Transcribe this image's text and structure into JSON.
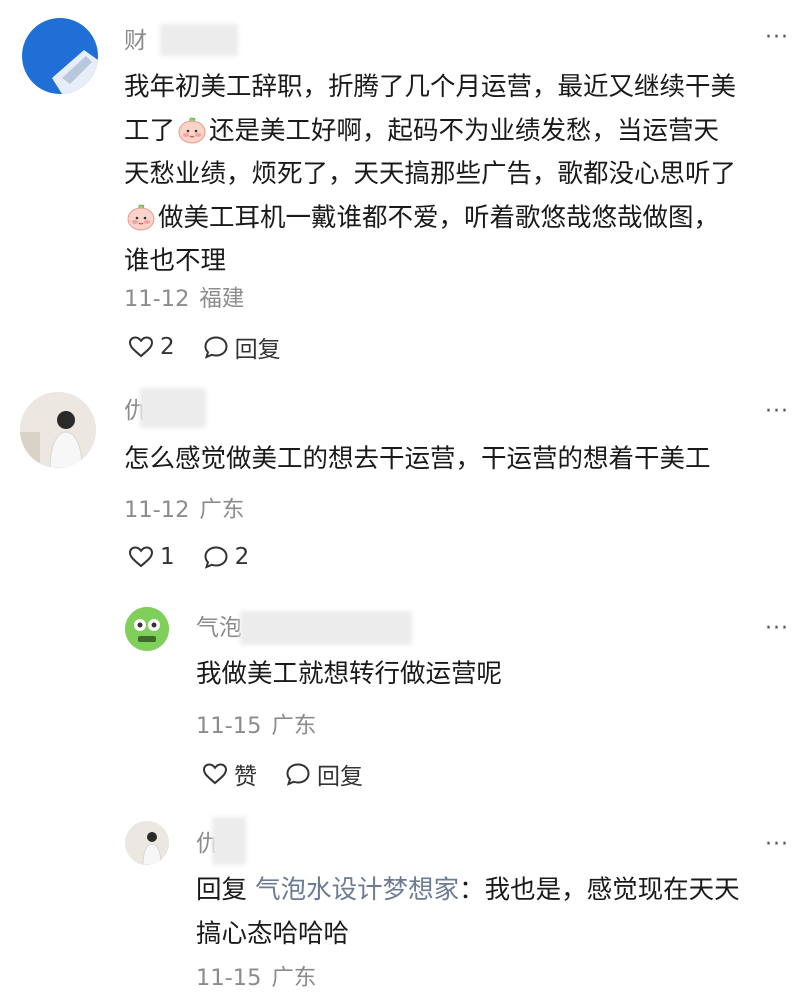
{
  "comments": [
    {
      "name_prefix": "财",
      "text_line1_a": "我年初美工辞职，折腾了几个月运营，最近又继续干美",
      "text_line2_a": "工了",
      "text_line2_b": "还是美工好啊，起码不为业绩发愁，当运营天",
      "text_line3": "天愁业绩，烦死了，天天搞那些广告，歌都没心思听了",
      "text_line4_b": "做美工耳机一戴谁都不爱，听着歌悠哉悠哉做图，",
      "text_line5": "谁也不理",
      "date": "11-12",
      "location": "福建",
      "like_count": "2",
      "reply_label": "回复",
      "emoji_icon": "baby-face-emoji"
    },
    {
      "name_prefix": "仇",
      "text": "怎么感觉做美工的想去干运营，干运营的想着干美工",
      "date": "11-12",
      "location": "广东",
      "like_count": "1",
      "reply_count": "2"
    }
  ],
  "replies": [
    {
      "name_prefix": "气泡",
      "text": "我做美工就想转行做运营呢",
      "date": "11-15",
      "location": "广东",
      "like_label": "赞",
      "reply_label": "回复"
    },
    {
      "name_prefix": "仇",
      "reply_prefix": "回复",
      "reply_to": "气泡水设计梦想家",
      "text_line1": "：我也是，感觉现在天天",
      "text_line2": "搞心态哈哈哈",
      "date": "11-15",
      "location": "广东"
    }
  ],
  "more_label": "···",
  "colors": {
    "meta": "#8c8c8c",
    "reply_name": "#6c7b95",
    "avatar_blue": "#1f6fd6"
  }
}
